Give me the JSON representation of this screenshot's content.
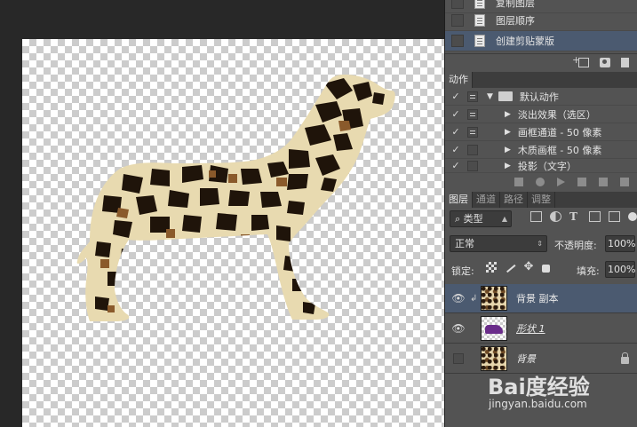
{
  "history": {
    "items": [
      {
        "label": "复制图层",
        "selected": false
      },
      {
        "label": "图层顺序",
        "selected": false
      },
      {
        "label": "创建剪贴蒙版",
        "selected": true
      }
    ]
  },
  "actions_panel": {
    "tab": "动作",
    "items": [
      {
        "checked": true,
        "dialog": true,
        "type": "set",
        "label": "默认动作"
      },
      {
        "checked": true,
        "dialog": true,
        "type": "action",
        "label": "淡出效果（选区）"
      },
      {
        "checked": true,
        "dialog": true,
        "type": "action",
        "label": "画框通道 - 50 像素"
      },
      {
        "checked": true,
        "dialog": false,
        "type": "action",
        "label": "木质画框 - 50 像素"
      },
      {
        "checked": true,
        "dialog": false,
        "type": "action",
        "label": "投影（文字）"
      }
    ]
  },
  "layers_panel": {
    "tabs": [
      "图层",
      "通道",
      "路径",
      "调整"
    ],
    "active_tab": "图层",
    "filter_kind": "类型",
    "blend_mode": "正常",
    "opacity_label": "不透明度:",
    "opacity_value": "100%",
    "lock_label": "锁定:",
    "fill_label": "填充:",
    "fill_value": "100%",
    "layers": [
      {
        "name": "背景 副本",
        "visible": true,
        "clipped": true,
        "thumb": "leopard",
        "selected": true,
        "locked": false,
        "italic": false
      },
      {
        "name": "形状 1",
        "visible": true,
        "clipped": false,
        "thumb": "shape",
        "selected": false,
        "locked": false,
        "italic": true
      },
      {
        "name": "背景",
        "visible": false,
        "clipped": false,
        "thumb": "leopard",
        "selected": false,
        "locked": true,
        "italic": true
      }
    ]
  },
  "canvas": {
    "art": "leopard-print dog silhouette on transparent background",
    "colors": {
      "base": "#e8dab0",
      "dark_spot": "#1f140a",
      "brown_spot": "#8a5a2b"
    }
  },
  "watermark": {
    "brand": "Bai度经验",
    "url": "jingyan.baidu.com"
  },
  "icons": {
    "visibility": "eye-icon",
    "folder": "folder-icon",
    "document": "document-icon",
    "lock": "lock-icon"
  }
}
